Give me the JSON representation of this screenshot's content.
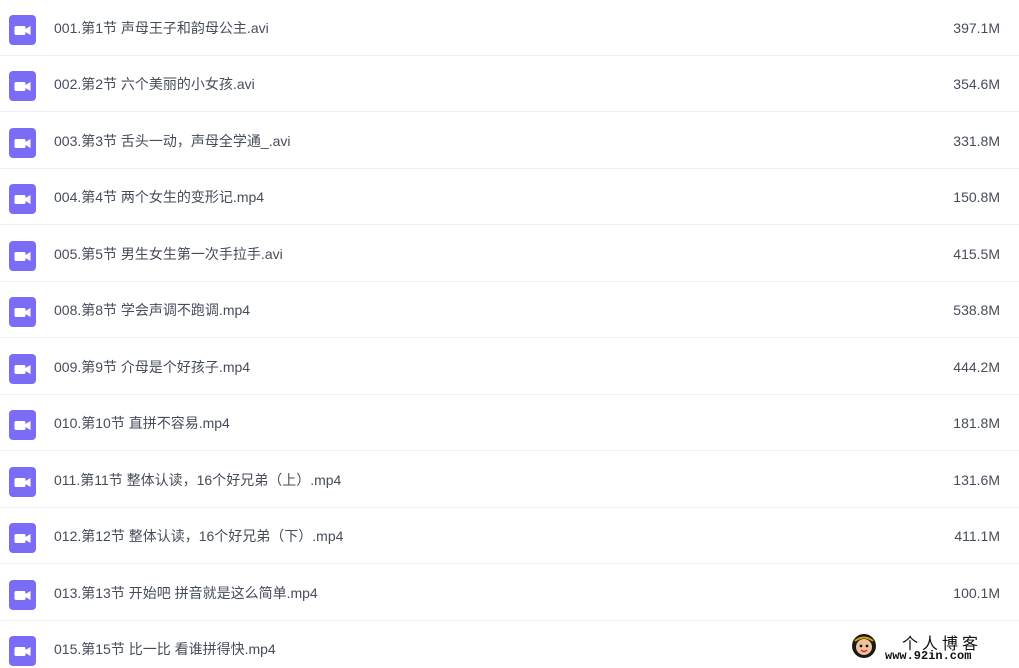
{
  "icon": {
    "name": "video-file-icon",
    "color": "#7b6cf6"
  },
  "files": [
    {
      "name": "001.第1节 声母王子和韵母公主.avi",
      "size": "397.1M"
    },
    {
      "name": "002.第2节 六个美丽的小女孩.avi",
      "size": "354.6M"
    },
    {
      "name": "003.第3节 舌头一动，声母全学通_.avi",
      "size": "331.8M"
    },
    {
      "name": "004.第4节 两个女生的变形记.mp4",
      "size": "150.8M"
    },
    {
      "name": "005.第5节 男生女生第一次手拉手.avi",
      "size": "415.5M"
    },
    {
      "name": "008.第8节 学会声调不跑调.mp4",
      "size": "538.8M"
    },
    {
      "name": "009.第9节 介母是个好孩子.mp4",
      "size": "444.2M"
    },
    {
      "name": "010.第10节 直拼不容易.mp4",
      "size": "181.8M"
    },
    {
      "name": "011.第11节 整体认读，16个好兄弟（上）.mp4",
      "size": "131.6M"
    },
    {
      "name": "012.第12节 整体认读，16个好兄弟（下）.mp4",
      "size": "411.1M"
    },
    {
      "name": "013.第13节 开始吧 拼音就是这么简单.mp4",
      "size": "100.1M"
    },
    {
      "name": "015.第15节 比一比 看谁拼得快.mp4",
      "size": ""
    }
  ],
  "watermark": {
    "title": "个人博客",
    "url": "www.92in.com"
  }
}
